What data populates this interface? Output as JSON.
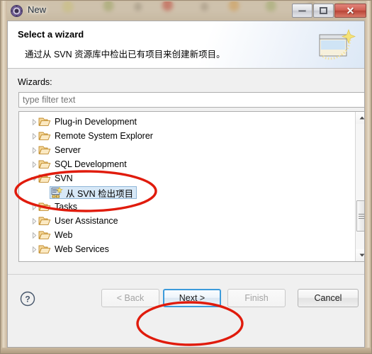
{
  "window": {
    "title": "New",
    "title_icon": "gear-icon",
    "buttons": {
      "minimize": "minimize-icon",
      "maximize": "restore-icon",
      "close": "✕"
    }
  },
  "header": {
    "title": "Select a wizard",
    "description": "通过从 SVN 资源库中检出已有项目来创建新项目。",
    "icon": "new-wizard-window-icon"
  },
  "body": {
    "wizards_label": "Wizards:",
    "filter": {
      "placeholder": "type filter text",
      "value": ""
    },
    "tree": [
      {
        "label": "Plug-in Development",
        "type": "folder",
        "expanded": false,
        "selected": false
      },
      {
        "label": "Remote System Explorer",
        "type": "folder",
        "expanded": false,
        "selected": false
      },
      {
        "label": "Server",
        "type": "folder",
        "expanded": false,
        "selected": false
      },
      {
        "label": "SQL Development",
        "type": "folder",
        "expanded": false,
        "selected": false
      },
      {
        "label": "SVN",
        "type": "folder",
        "expanded": true,
        "selected": false
      },
      {
        "label": "从 SVN 检出项目",
        "type": "wizard",
        "expanded": false,
        "selected": true
      },
      {
        "label": "Tasks",
        "type": "folder",
        "expanded": false,
        "selected": false
      },
      {
        "label": "User Assistance",
        "type": "folder",
        "expanded": false,
        "selected": false
      },
      {
        "label": "Web",
        "type": "folder",
        "expanded": false,
        "selected": false
      },
      {
        "label": "Web Services",
        "type": "folder",
        "expanded": false,
        "selected": false
      }
    ],
    "scrollbar": {
      "up_arrow": "scroll-up-icon",
      "down_arrow": "scroll-down-icon"
    }
  },
  "footer": {
    "help_icon": "help-question-icon",
    "back_label": "< Back",
    "next_label": "Next >",
    "finish_label": "Finish",
    "cancel_label": "Cancel"
  },
  "annotations": {
    "highlight_color": "#e01b0c",
    "circles": [
      "tree-selection-highlight",
      "next-button-highlight"
    ]
  }
}
